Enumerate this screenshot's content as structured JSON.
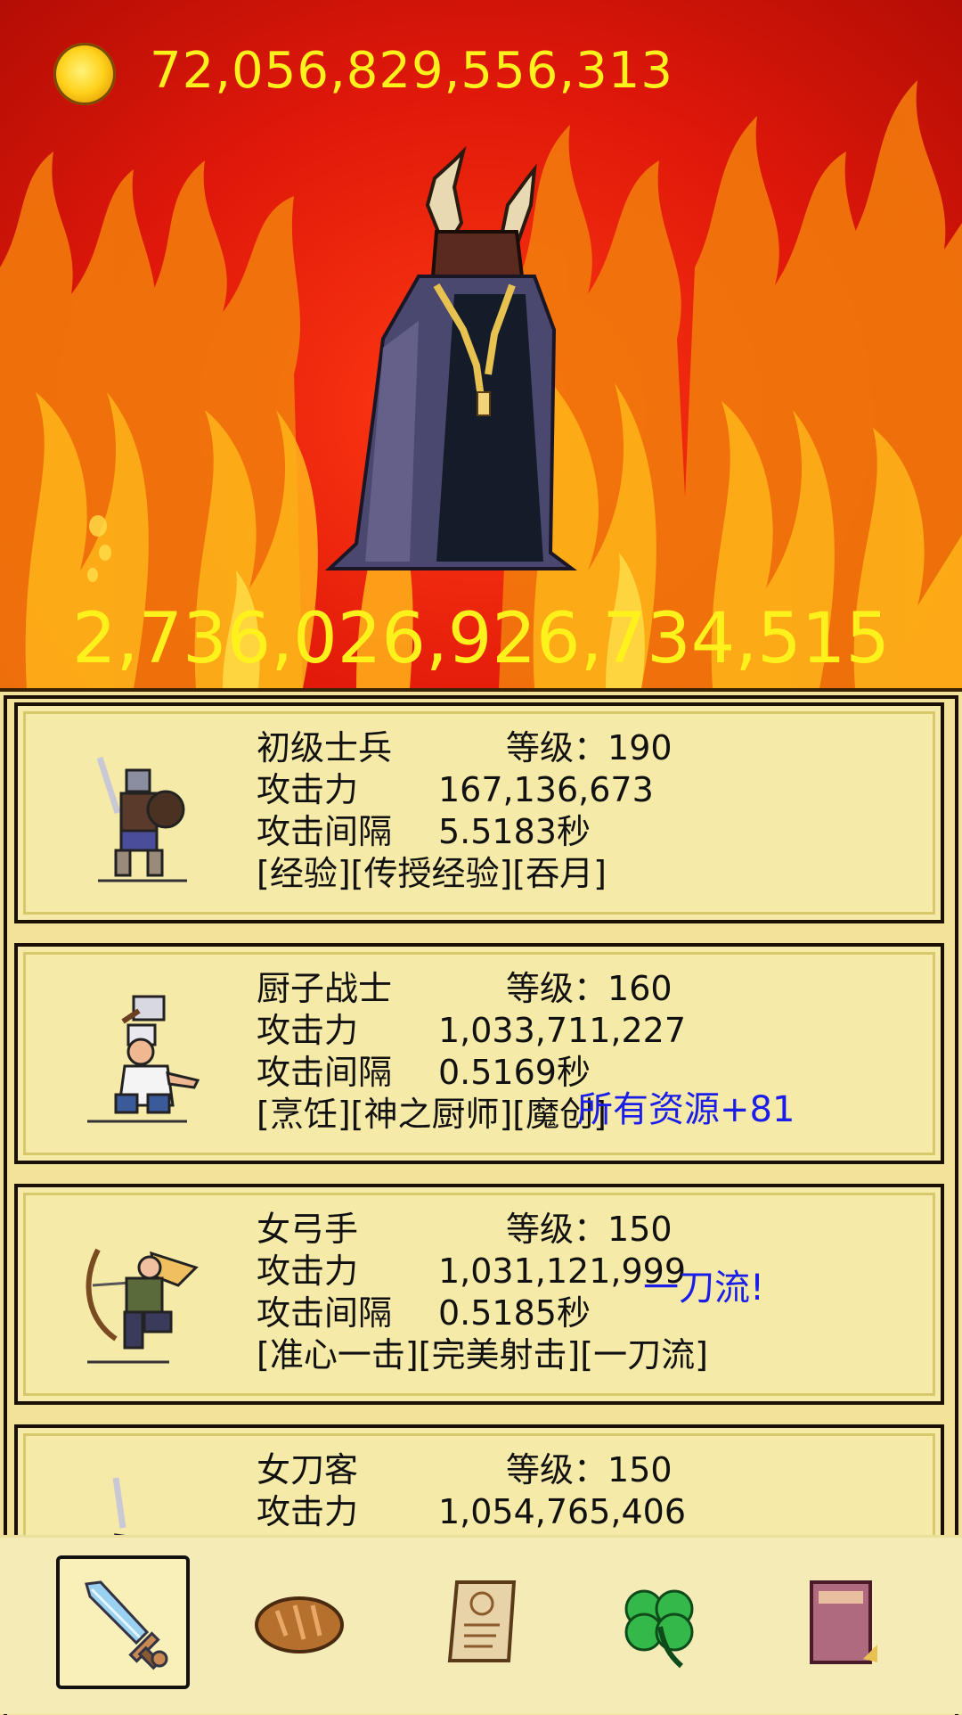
{
  "header": {
    "coins": "72,056,829,556,313",
    "coin_icon": "gold-coin-icon"
  },
  "battle": {
    "boss_icon": "horned-cloaked-demon-icon",
    "damage": "2,736,026,926,734,515"
  },
  "units": [
    {
      "name": "初级士兵",
      "level_label": "等级：",
      "level": "190",
      "attack_label": "攻击力",
      "attack": "167,136,673",
      "interval_label": "攻击间隔",
      "interval": "5.5183秒",
      "skills": "[经验][传授经验][吞月]",
      "icon": "soldier-with-shield-icon"
    },
    {
      "name": "厨子战士",
      "level_label": "等级：",
      "level": "160",
      "attack_label": "攻击力",
      "attack": "1,033,711,227",
      "interval_label": "攻击间隔",
      "interval": "0.5169秒",
      "skills": "[烹饪][神之厨师][魔创]",
      "icon": "chef-with-cleaver-icon"
    },
    {
      "name": "女弓手",
      "level_label": "等级：",
      "level": "150",
      "attack_label": "攻击力",
      "attack": "1,031,121,999",
      "interval_label": "攻击间隔",
      "interval": "0.5185秒",
      "skills": "[准心一击][完美射击][一刀流]",
      "icon": "female-archer-icon"
    },
    {
      "name": "女刀客",
      "level_label": "等级：",
      "level": "150",
      "attack_label": "攻击力",
      "attack": "1,054,765,406",
      "icon": "female-swordswoman-icon"
    }
  ],
  "floating_texts": {
    "resource_bonus": "所有资源+81",
    "skill_proc": "一刀流!"
  },
  "tabs": [
    {
      "icon": "sword-icon",
      "active": true
    },
    {
      "icon": "bread-icon",
      "active": false
    },
    {
      "icon": "scroll-icon",
      "active": false
    },
    {
      "icon": "clover-icon",
      "active": false
    },
    {
      "icon": "book-icon",
      "active": false
    }
  ],
  "colors": {
    "gold_text": "#fff21c",
    "panel_bg": "#f6eaa8",
    "float_text": "#1a1ee8",
    "fire_red": "#e0180a"
  }
}
